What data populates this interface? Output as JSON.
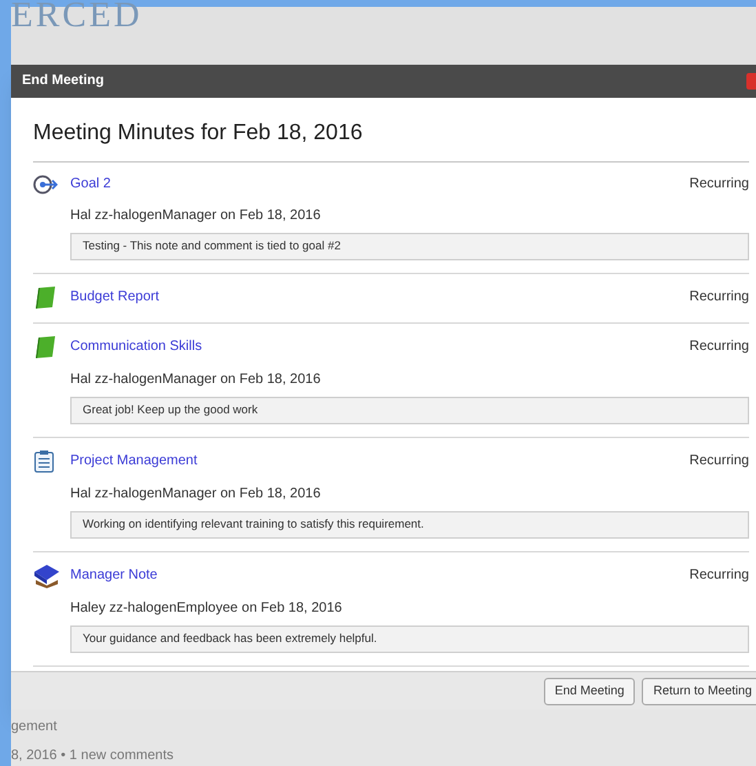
{
  "background": {
    "logo_text": "ERCED",
    "bottom_title": "gement",
    "bottom_meta": "8, 2016 • 1 new comments"
  },
  "dialog": {
    "title": "End Meeting",
    "heading": "Meeting Minutes for Feb 18, 2016",
    "items": [
      {
        "kind": "goal",
        "title": "Goal 2",
        "status": "Recurring",
        "author": "Hal zz-halogenManager on Feb 18, 2016",
        "comment": "Testing - This note and comment is tied to goal #2"
      },
      {
        "kind": "book",
        "title": "Budget Report",
        "status": "Recurring"
      },
      {
        "kind": "book",
        "title": "Communication Skills",
        "status": "Recurring",
        "author": "Hal zz-halogenManager on Feb 18, 2016",
        "comment": "Great job! Keep up the good work"
      },
      {
        "kind": "clipboard",
        "title": "Project Management",
        "status": "Recurring",
        "author": "Hal zz-halogenManager on Feb 18, 2016",
        "comment": "Working on identifying relevant training to satisfy this requirement."
      },
      {
        "kind": "note",
        "title": "Manager Note",
        "status": "Recurring",
        "author": "Haley zz-halogenEmployee on Feb 18, 2016",
        "comment": "Your guidance and feedback has been extremely helpful."
      }
    ],
    "buttons": [
      "End Meeting",
      "Return to Meeting"
    ]
  }
}
